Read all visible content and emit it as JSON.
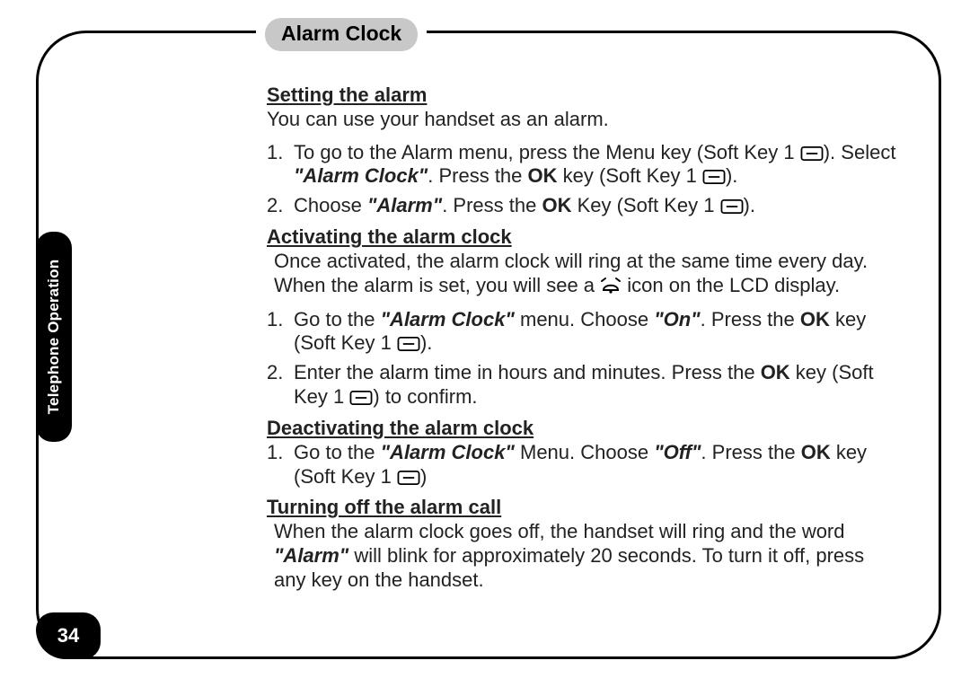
{
  "side_tab": "Telephone Operation",
  "page_number": "34",
  "section_title": "Alarm Clock",
  "s1_head": "Setting the alarm",
  "s1_intro": "You can use your handset as an alarm.",
  "s1_n1": "1.",
  "s1_1a": "To go to the Alarm menu, press the Menu key (Soft Key 1 ",
  "s1_1b": "). Select ",
  "s1_1c": "\"Alarm Clock\"",
  "s1_1d": ". Press the ",
  "s1_1e": "OK",
  "s1_1f": " key (Soft Key 1 ",
  "s1_1g": ").",
  "s1_n2": "2.",
  "s1_2a": "Choose ",
  "s1_2b": "\"Alarm\"",
  "s1_2c": ". Press the ",
  "s1_2d": "OK",
  "s1_2e": " Key (Soft Key 1 ",
  "s1_2f": ").",
  "s2_head": "Activating the alarm clock",
  "s2_p1a": "Once activated, the alarm clock will ring at the same time every day. When the alarm is set, you will see a ",
  "s2_p1b": " icon on the LCD display.",
  "s2_n1": "1.",
  "s2_1a": "Go to the ",
  "s2_1b": "\"Alarm Clock\"",
  "s2_1c": " menu. Choose ",
  "s2_1d": "\"On\"",
  "s2_1e": ". Press the ",
  "s2_1f": "OK",
  "s2_1g": " key (Soft Key 1 ",
  "s2_1h": ").",
  "s2_n2": "2.",
  "s2_2a": "Enter the alarm time in hours and minutes. Press the ",
  "s2_2b": "OK",
  "s2_2c": " key (Soft Key 1 ",
  "s2_2d": ") to confirm.",
  "s3_head": "Deactivating the alarm clock",
  "s3_n1": "1.",
  "s3_1a": "Go to the ",
  "s3_1b": "\"Alarm Clock\"",
  "s3_1c": " Menu. Choose ",
  "s3_1d": "\"Off\"",
  "s3_1e": ". Press the ",
  "s3_1f": "OK",
  "s3_1g": " key (Soft Key 1 ",
  "s3_1h": ")",
  "s4_head": "Turning off the alarm call",
  "s4_p1a": "When the alarm clock goes off, the handset will ring and the word ",
  "s4_p1b": "\"Alarm\"",
  "s4_p1c": " will blink for approximately 20 seconds. To turn it off, press any key on the handset."
}
